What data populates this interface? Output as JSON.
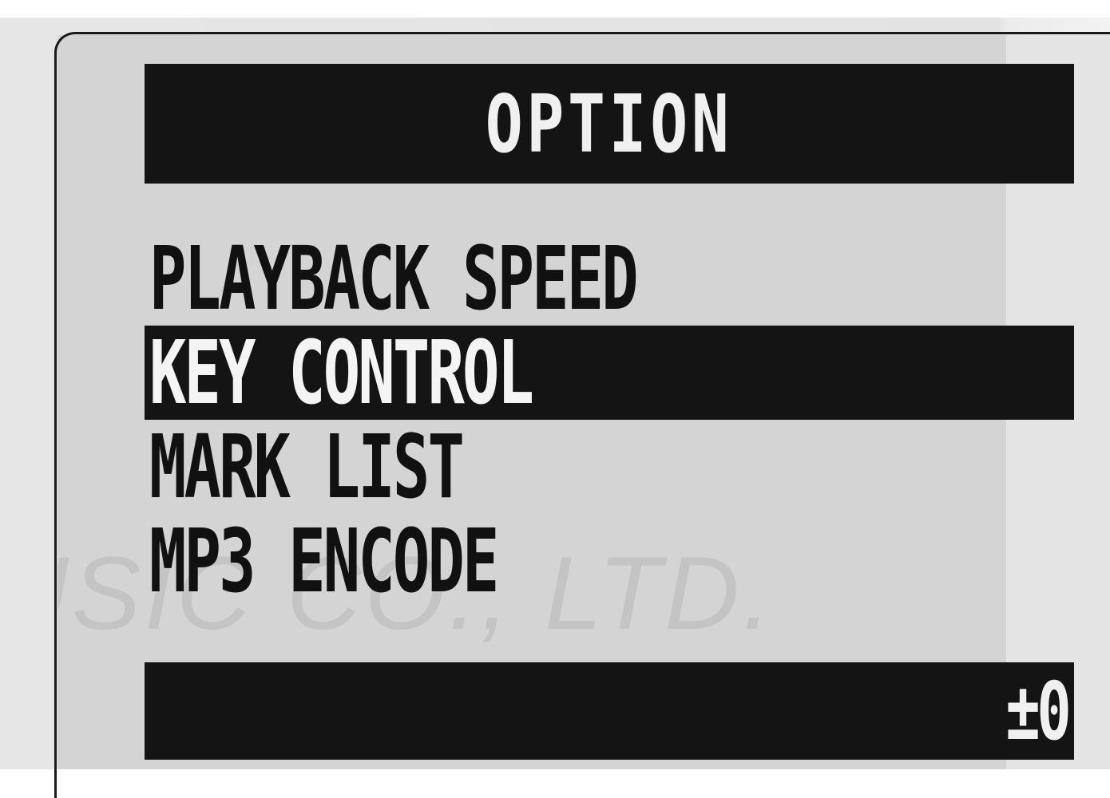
{
  "screen": {
    "title": "OPTION",
    "watermark": "USIC CO., LTD.",
    "menu": {
      "items": [
        {
          "label": "PLAYBACK SPEED",
          "selected": false
        },
        {
          "label": "KEY CONTROL",
          "selected": true
        },
        {
          "label": "MARK LIST",
          "selected": false
        },
        {
          "label": "MP3 ENCODE",
          "selected": false
        }
      ]
    },
    "status": {
      "value": "±0"
    }
  },
  "colors": {
    "bar": "#141414",
    "lcd_background": "#d4d4d4",
    "text_dark": "#111111",
    "text_light": "#f0f0f0"
  }
}
